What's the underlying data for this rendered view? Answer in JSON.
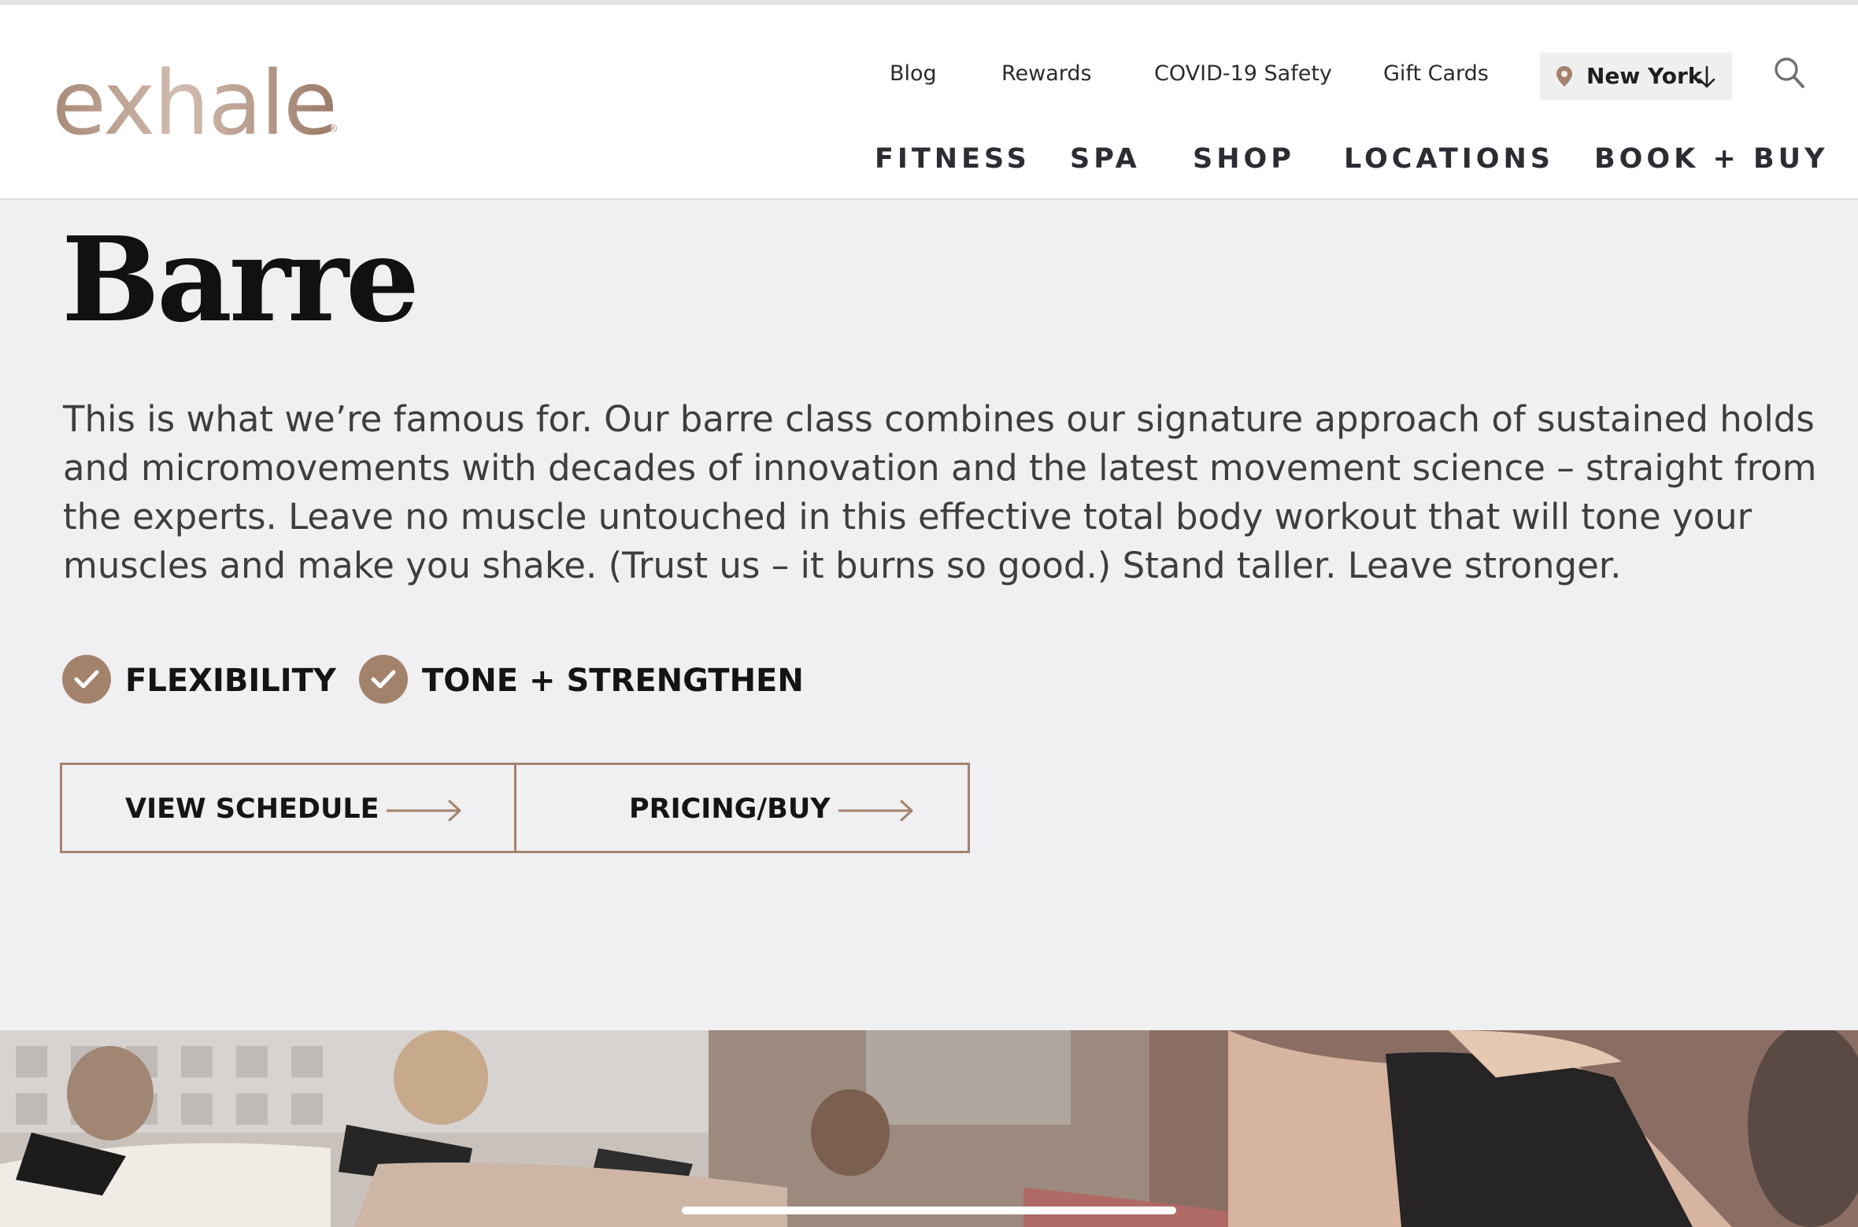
{
  "brand": {
    "logo_text": "exhale",
    "logo_mark": "®",
    "accent": "#a3826c"
  },
  "utility_nav": [
    {
      "label": "Blog"
    },
    {
      "label": "Rewards"
    },
    {
      "label": "COVID-19 Safety"
    },
    {
      "label": "Gift Cards"
    }
  ],
  "location": {
    "selected": "New York",
    "icon": "map-pin-icon",
    "toggle_icon": "arrow-down-icon"
  },
  "search": {
    "icon": "search-icon"
  },
  "main_nav": [
    {
      "label": "FITNESS"
    },
    {
      "label": "SPA"
    },
    {
      "label": "SHOP"
    },
    {
      "label": "LOCATIONS"
    },
    {
      "label": "BOOK + BUY"
    }
  ],
  "page": {
    "title": "Barre",
    "description": "This is what we’re famous for. Our barre class combines our signature approach of sustained holds and micromovements with decades of innovation and the latest movement science – straight from the experts. Leave no muscle untouched in this effective total body workout that will tone your muscles and make you shake. (Trust us – it burns so good.) Stand taller. Leave stronger.",
    "features": [
      {
        "label": "FLEXIBILITY",
        "icon": "check-circle-icon"
      },
      {
        "label": "TONE + STRENGTHEN",
        "icon": "check-circle-icon"
      }
    ],
    "actions": [
      {
        "label": "VIEW SCHEDULE",
        "icon": "arrow-right-icon"
      },
      {
        "label": "PRICING/BUY",
        "icon": "arrow-right-icon"
      }
    ]
  },
  "hero": {
    "image": "barre-class-photo"
  }
}
